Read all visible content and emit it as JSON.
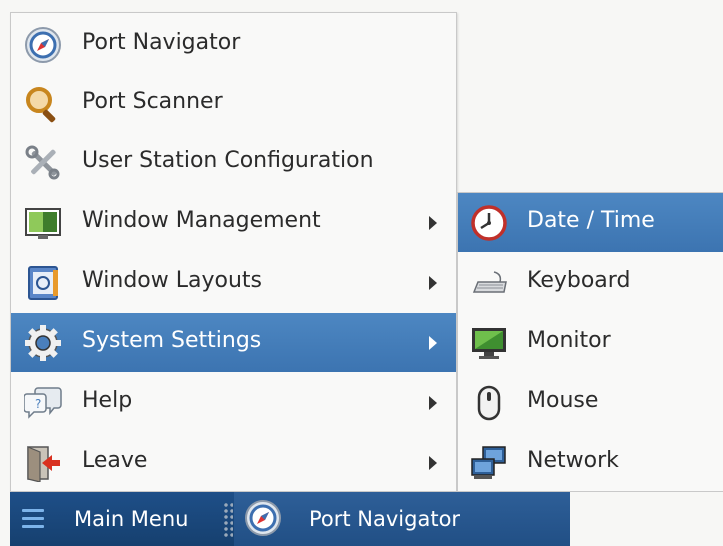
{
  "main_menu": {
    "items": [
      {
        "label": "Port Navigator",
        "icon": "compass-icon",
        "has_submenu": false
      },
      {
        "label": "Port Scanner",
        "icon": "magnifier-icon",
        "has_submenu": false
      },
      {
        "label": "User Station Configuration",
        "icon": "tools-icon",
        "has_submenu": false
      },
      {
        "label": "Window Management",
        "icon": "window-management-icon",
        "has_submenu": true
      },
      {
        "label": "Window Layouts",
        "icon": "window-layouts-icon",
        "has_submenu": true
      },
      {
        "label": "System Settings",
        "icon": "gear-icon",
        "has_submenu": true,
        "active": true
      },
      {
        "label": "Help",
        "icon": "help-bubbles-icon",
        "has_submenu": true
      },
      {
        "label": "Leave",
        "icon": "exit-door-icon",
        "has_submenu": true
      }
    ]
  },
  "system_settings_submenu": {
    "items": [
      {
        "label": "Date / Time",
        "icon": "clock-icon",
        "active": true
      },
      {
        "label": "Keyboard",
        "icon": "keyboard-icon"
      },
      {
        "label": "Monitor",
        "icon": "monitor-icon"
      },
      {
        "label": "Mouse",
        "icon": "mouse-icon"
      },
      {
        "label": "Network",
        "icon": "network-icon"
      }
    ]
  },
  "taskbar": {
    "main_menu_label": "Main Menu",
    "task_label": "Port Navigator"
  },
  "colors": {
    "highlight": "#4279b6",
    "taskbar": "#1b4a80",
    "menu_bg": "#f9f9f8"
  }
}
